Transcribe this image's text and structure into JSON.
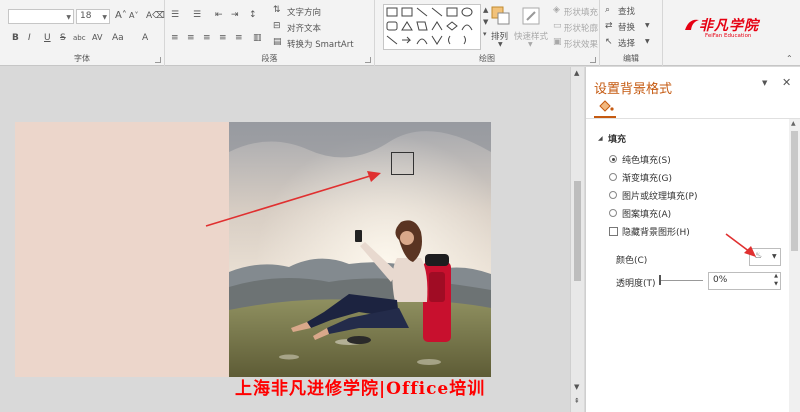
{
  "ribbon": {
    "font_group": {
      "label": "字体",
      "font_size": "18",
      "buttons": [
        "B",
        "I",
        "U",
        "S",
        "abc",
        "AV",
        "Aa",
        "A"
      ],
      "grow": "A",
      "shrink": "A",
      "clear": "A"
    },
    "paragraph_group": {
      "label": "段落",
      "text_direction": "文字方向",
      "align_text": "对齐文本",
      "convert_smartart": "转换为 SmartArt"
    },
    "drawing_group": {
      "label": "绘图",
      "arrange": "排列",
      "quick_styles": "快速样式",
      "shape_fill": "形状填充",
      "shape_outline": "形状轮廓",
      "shape_effects": "形状效果"
    },
    "editing_group": {
      "label": "编辑",
      "find": "查找",
      "replace": "替换",
      "select": "选择"
    },
    "logo": {
      "name": "非凡学院",
      "subtitle": "FeiFan Education"
    }
  },
  "watermark": "上海非凡进修学院|Office培训",
  "pane": {
    "title": "设置背景格式",
    "section": "填充",
    "options": [
      {
        "label": "纯色填充(S)",
        "selected": true
      },
      {
        "label": "渐变填充(G)",
        "selected": false
      },
      {
        "label": "图片或纹理填充(P)",
        "selected": false
      },
      {
        "label": "图案填充(A)",
        "selected": false
      }
    ],
    "hide_bg": {
      "label": "隐藏背景图形(H)",
      "checked": false
    },
    "color_label": "颜色(C)",
    "transparency_label": "透明度(T)",
    "transparency_value": "0%",
    "transparency_fraction": 0
  },
  "colors": {
    "accent": "#c55a11",
    "slide_fill": "#ecd6cb",
    "arrow": "#e03030",
    "logo_red": "#e60012",
    "watermark": "#ff0000"
  }
}
